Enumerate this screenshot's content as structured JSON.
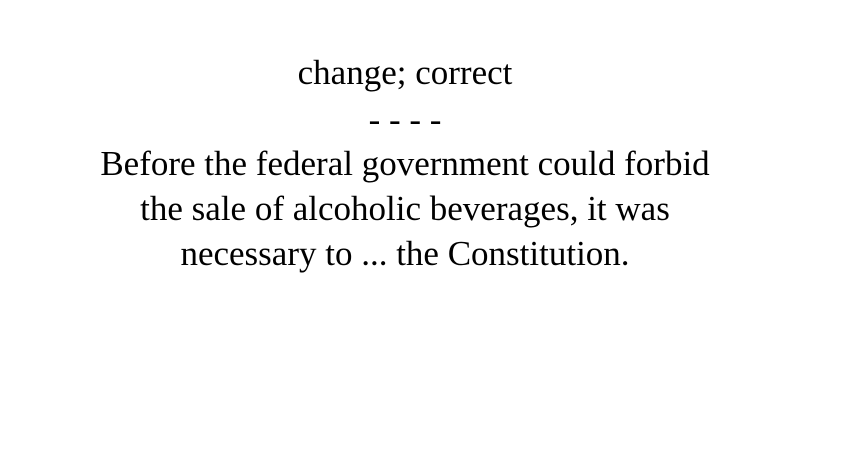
{
  "card": {
    "definition": "change; correct",
    "separator": "- - - -",
    "sentence_lines": [
      "Before the federal government could forbid",
      "the sale of alcoholic beverages, it was",
      "necessary to ... the Constitution."
    ]
  }
}
